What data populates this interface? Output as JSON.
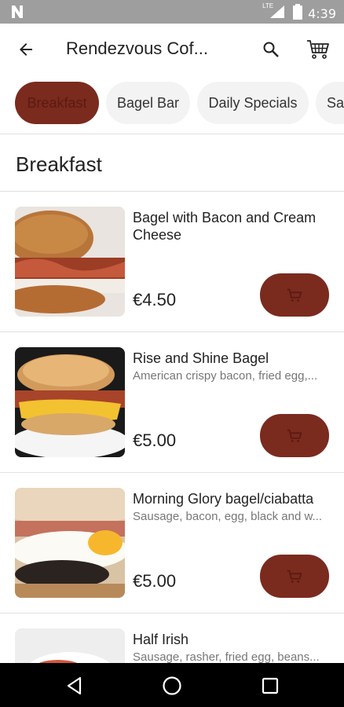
{
  "status_bar": {
    "time": "4:39",
    "network_label": "LTE",
    "icons": [
      "notification-n-icon",
      "signal-icon",
      "battery-icon"
    ]
  },
  "app_bar": {
    "title": "Rendezvous Cof...",
    "icons": [
      "back-arrow-icon",
      "search-icon",
      "cart-icon"
    ]
  },
  "categories": [
    {
      "label": "Breakfast",
      "selected": true
    },
    {
      "label": "Bagel Bar",
      "selected": false
    },
    {
      "label": "Daily Specials",
      "selected": false
    },
    {
      "label": "Sa",
      "selected": false
    }
  ],
  "section": {
    "title": "Breakfast"
  },
  "items": [
    {
      "name": "Bagel with Bacon and Cream Cheese",
      "description": "",
      "price": "€4.50"
    },
    {
      "name": "Rise and Shine Bagel",
      "description": "American crispy bacon, fried egg,...",
      "price": "€5.00"
    },
    {
      "name": "Morning Glory bagel/ciabatta",
      "description": "Sausage, bacon, egg, black and w...",
      "price": "€5.00"
    },
    {
      "name": "Half Irish",
      "description": "Sausage, rasher, fried egg, beans...",
      "price": ""
    }
  ],
  "colors": {
    "accent": "#7b2a1e",
    "status_bar": "#9e9e9e",
    "nav_bar": "#000000",
    "chip_inactive": "#f3f3f3"
  },
  "nav_bar": {
    "icons": [
      "nav-back-icon",
      "nav-home-icon",
      "nav-recents-icon"
    ]
  }
}
